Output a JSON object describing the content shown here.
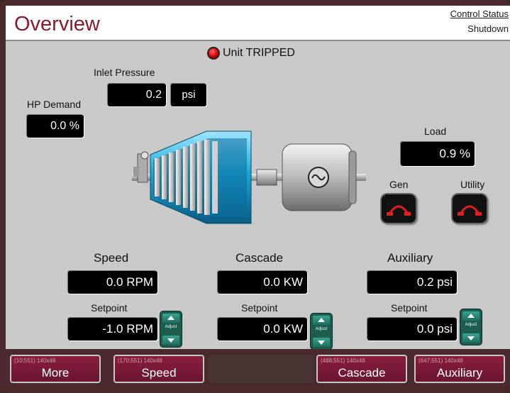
{
  "header": {
    "title": "Overview",
    "control_status_link": "Control Status",
    "control_status_value": "Shutdown"
  },
  "trip": {
    "text": "Unit TRIPPED",
    "led_color": "#d40000"
  },
  "inlet_pressure": {
    "label": "Inlet Pressure",
    "value": "0.2",
    "unit": "psi"
  },
  "hp_demand": {
    "label": "HP Demand",
    "value": "0.0 %"
  },
  "load": {
    "label": "Load",
    "value": "0.9 %"
  },
  "breakers": {
    "gen_label": "Gen",
    "utility_label": "Utility"
  },
  "panels": [
    {
      "title": "Speed",
      "value": "0.0 RPM",
      "setpoint_label": "Setpoint",
      "setpoint_value": "-1.0 RPM",
      "adjust_label": "Adjust"
    },
    {
      "title": "Cascade",
      "value": "0.0 KW",
      "setpoint_label": "Setpoint",
      "setpoint_value": "0.0 KW",
      "adjust_label": "Adjust"
    },
    {
      "title": "Auxiliary",
      "value": "0.2 psi",
      "setpoint_label": "Setpoint",
      "setpoint_value": "0.0 psi",
      "adjust_label": "Adjust"
    }
  ],
  "nav": [
    {
      "label": "More",
      "tag": "(10;551) 140x48"
    },
    {
      "label": "Speed",
      "tag": "(170;551) 140x48"
    },
    {
      "label": "Cascade",
      "tag": "(488;551) 140x48"
    },
    {
      "label": "Auxiliary",
      "tag": "(647;551) 140x48"
    }
  ],
  "colors": {
    "brand": "#8b1a2c",
    "nav_button": "#7a1a36",
    "stepper": "#1d5d50",
    "turbine": "#1aa8d8"
  }
}
